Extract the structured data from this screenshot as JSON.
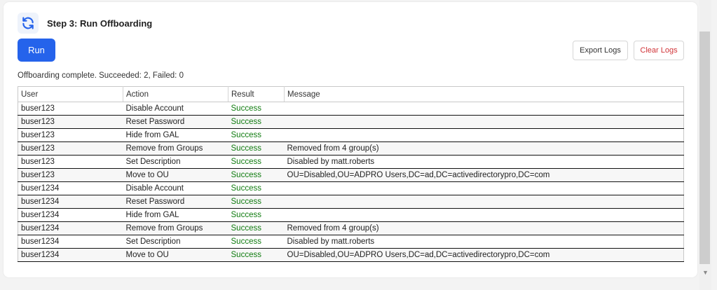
{
  "header": {
    "title": "Step 3: Run Offboarding",
    "icon": "refresh-icon"
  },
  "toolbar": {
    "run_label": "Run",
    "export_label": "Export Logs",
    "clear_label": "Clear Logs"
  },
  "status": {
    "text": "Offboarding complete. Succeeded: 2, Failed: 0"
  },
  "table": {
    "columns": [
      "User",
      "Action",
      "Result",
      "Message"
    ],
    "rows": [
      {
        "user": "buser123",
        "action": "Disable Account",
        "result": "Success",
        "message": ""
      },
      {
        "user": "buser123",
        "action": "Reset Password",
        "result": "Success",
        "message": ""
      },
      {
        "user": "buser123",
        "action": "Hide from GAL",
        "result": "Success",
        "message": ""
      },
      {
        "user": "buser123",
        "action": "Remove from Groups",
        "result": "Success",
        "message": "Removed from 4 group(s)"
      },
      {
        "user": "buser123",
        "action": "Set Description",
        "result": "Success",
        "message": "Disabled by matt.roberts"
      },
      {
        "user": "buser123",
        "action": "Move to OU",
        "result": "Success",
        "message": "OU=Disabled,OU=ADPRO Users,DC=ad,DC=activedirectorypro,DC=com"
      },
      {
        "user": "buser1234",
        "action": "Disable Account",
        "result": "Success",
        "message": ""
      },
      {
        "user": "buser1234",
        "action": "Reset Password",
        "result": "Success",
        "message": ""
      },
      {
        "user": "buser1234",
        "action": "Hide from GAL",
        "result": "Success",
        "message": ""
      },
      {
        "user": "buser1234",
        "action": "Remove from Groups",
        "result": "Success",
        "message": "Removed from 4 group(s)"
      },
      {
        "user": "buser1234",
        "action": "Set Description",
        "result": "Success",
        "message": "Disabled by matt.roberts"
      },
      {
        "user": "buser1234",
        "action": "Move to OU",
        "result": "Success",
        "message": "OU=Disabled,OU=ADPRO Users,DC=ad,DC=activedirectorypro,DC=com"
      }
    ]
  },
  "colors": {
    "accent": "#2563eb",
    "success": "#107c10",
    "danger": "#d13438"
  }
}
